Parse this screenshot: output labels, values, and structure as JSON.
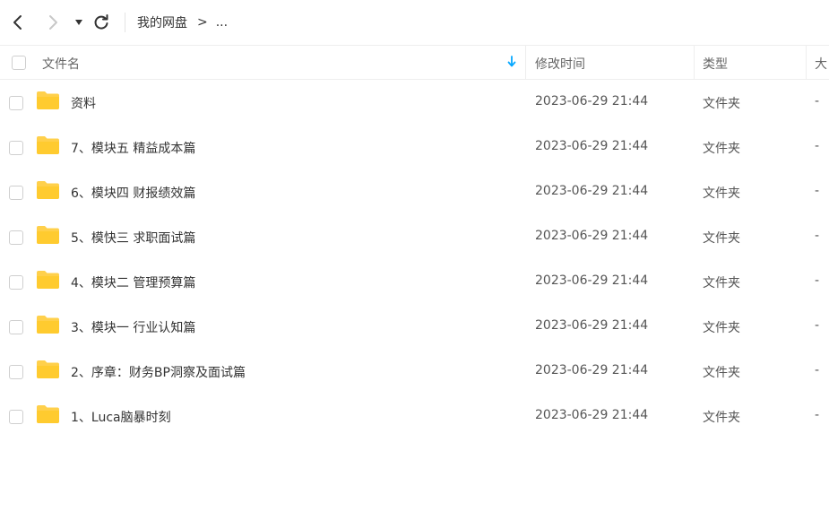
{
  "toolbar": {
    "breadcrumb_root": "我的网盘",
    "breadcrumb_separator": ">",
    "breadcrumb_more": "..."
  },
  "columns": {
    "name": "文件名",
    "modified": "修改时间",
    "type": "类型",
    "size": "大"
  },
  "colors": {
    "folder": "#FFD04B",
    "sort_arrow": "#06A7FF",
    "border": "#EEEEEE"
  },
  "files": [
    {
      "name": "资料",
      "modified": "2023-06-29 21:44",
      "type": "文件夹",
      "size": "-"
    },
    {
      "name": "7、模块五 精益成本篇",
      "modified": "2023-06-29 21:44",
      "type": "文件夹",
      "size": "-"
    },
    {
      "name": "6、模块四  财报绩效篇",
      "modified": "2023-06-29 21:44",
      "type": "文件夹",
      "size": "-"
    },
    {
      "name": "5、模快三 求职面试篇",
      "modified": "2023-06-29 21:44",
      "type": "文件夹",
      "size": "-"
    },
    {
      "name": "4、模块二 管理预算篇",
      "modified": "2023-06-29 21:44",
      "type": "文件夹",
      "size": "-"
    },
    {
      "name": "3、模块一 行业认知篇",
      "modified": "2023-06-29 21:44",
      "type": "文件夹",
      "size": "-"
    },
    {
      "name": "2、序章：财务BP洞察及面试篇",
      "modified": "2023-06-29 21:44",
      "type": "文件夹",
      "size": "-"
    },
    {
      "name": "1、Luca脑暴时刻",
      "modified": "2023-06-29 21:44",
      "type": "文件夹",
      "size": "-"
    }
  ]
}
